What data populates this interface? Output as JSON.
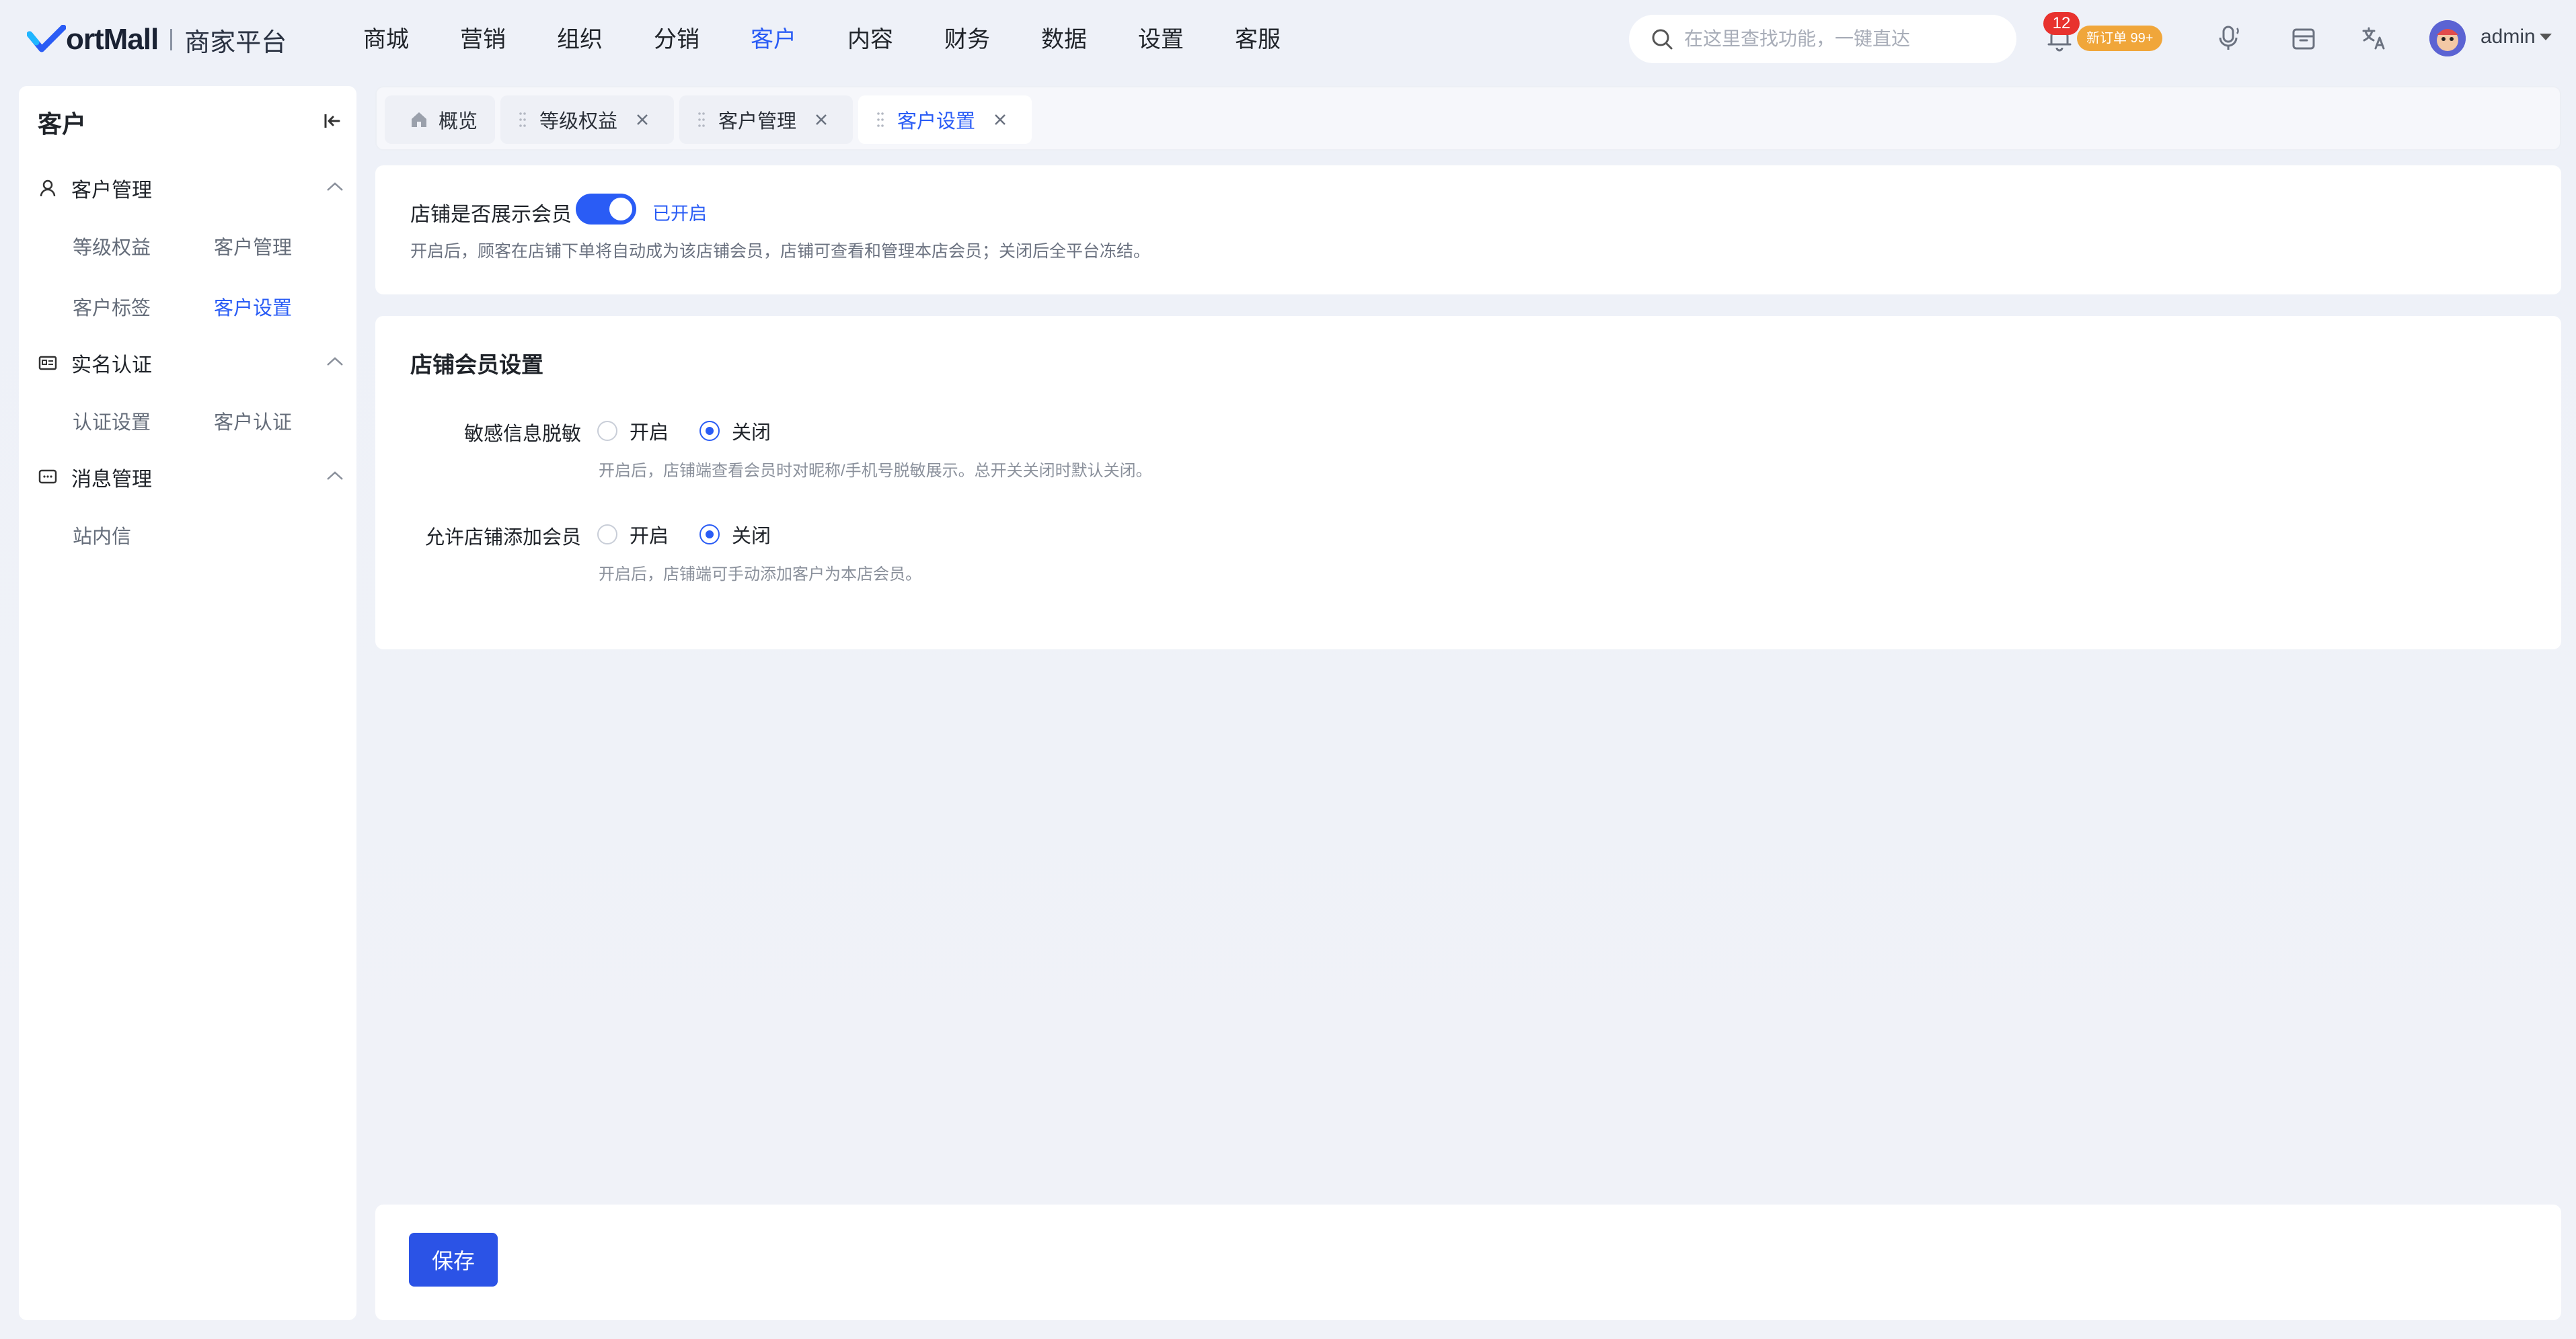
{
  "brand": {
    "name": "ortMall",
    "subtitle": "商家平台"
  },
  "topnav": {
    "items": [
      {
        "label": "商城"
      },
      {
        "label": "营销"
      },
      {
        "label": "组织"
      },
      {
        "label": "分销"
      },
      {
        "label": "客户"
      },
      {
        "label": "内容"
      },
      {
        "label": "财务"
      },
      {
        "label": "数据"
      },
      {
        "label": "设置"
      },
      {
        "label": "客服"
      }
    ],
    "active": "客户"
  },
  "search": {
    "placeholder": "在这里查找功能，一键直达"
  },
  "notifications": {
    "count": "12",
    "order_badge": "新订单 99+"
  },
  "user": {
    "name": "admin"
  },
  "sidebar": {
    "title": "客户",
    "groups": [
      {
        "label": "客户管理",
        "icon": "user-icon",
        "links": [
          "等级权益",
          "客户管理",
          "客户标签",
          "客户设置"
        ]
      },
      {
        "label": "实名认证",
        "icon": "id-card-icon",
        "links": [
          "认证设置",
          "客户认证"
        ]
      },
      {
        "label": "消息管理",
        "icon": "message-icon",
        "links": [
          "站内信"
        ]
      }
    ],
    "active_link": "客户设置"
  },
  "tabs": [
    {
      "label": "概览",
      "icon": "home-icon",
      "closable": false
    },
    {
      "label": "等级权益",
      "closable": true
    },
    {
      "label": "客户管理",
      "closable": true
    },
    {
      "label": "客户设置",
      "closable": true,
      "active": true
    }
  ],
  "member_display": {
    "label": "店铺是否展示会员",
    "enabled": true,
    "state_text": "已开启",
    "hint": "开启后，顾客在店铺下单将自动成为该店铺会员，店铺可查看和管理本店会员；关闭后全平台冻结。"
  },
  "member_settings": {
    "title": "店铺会员设置",
    "fields": [
      {
        "label": "敏感信息脱敏",
        "options": [
          "开启",
          "关闭"
        ],
        "selected": "关闭",
        "hint": "开启后，店铺端查看会员时对昵称/手机号脱敏展示。总开关关闭时默认关闭。"
      },
      {
        "label": "允许店铺添加会员",
        "options": [
          "开启",
          "关闭"
        ],
        "selected": "关闭",
        "hint": "开启后，店铺端可手动添加客户为本店会员。"
      }
    ]
  },
  "footer": {
    "save_label": "保存"
  },
  "colors": {
    "accent": "#2a5cf5",
    "badge_red": "#e8322e",
    "badge_orange": "#f0a63a"
  }
}
